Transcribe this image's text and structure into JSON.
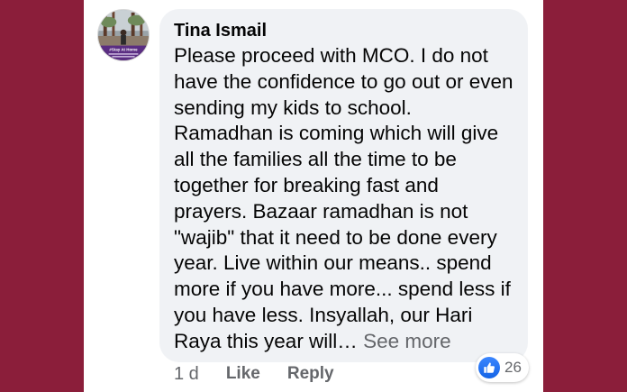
{
  "comment": {
    "author": "Tina Ismail",
    "text": "Please proceed with MCO. I do not have the confidence to go out or even sending my kids to school. Ramadhan is coming which will give all the families all the time to be together for breaking fast and prayers. Bazaar ramadhan is not \"wajib\" that it need to be done every year. Live within our means.. spend more if you have more... spend less if you have less. Insyallah, our Hari Raya this year will…",
    "see_more": "See more",
    "avatar_caption": "#Stay At Home"
  },
  "actions": {
    "time": "1 d",
    "like": "Like",
    "reply": "Reply"
  },
  "reactions": {
    "icon": "thumbs-up-icon",
    "count": "26"
  },
  "colors": {
    "background": "#8b1e3a",
    "bubble": "#f0f2f5",
    "secondary_text": "#65676b",
    "like_blue": "#1877f2"
  }
}
